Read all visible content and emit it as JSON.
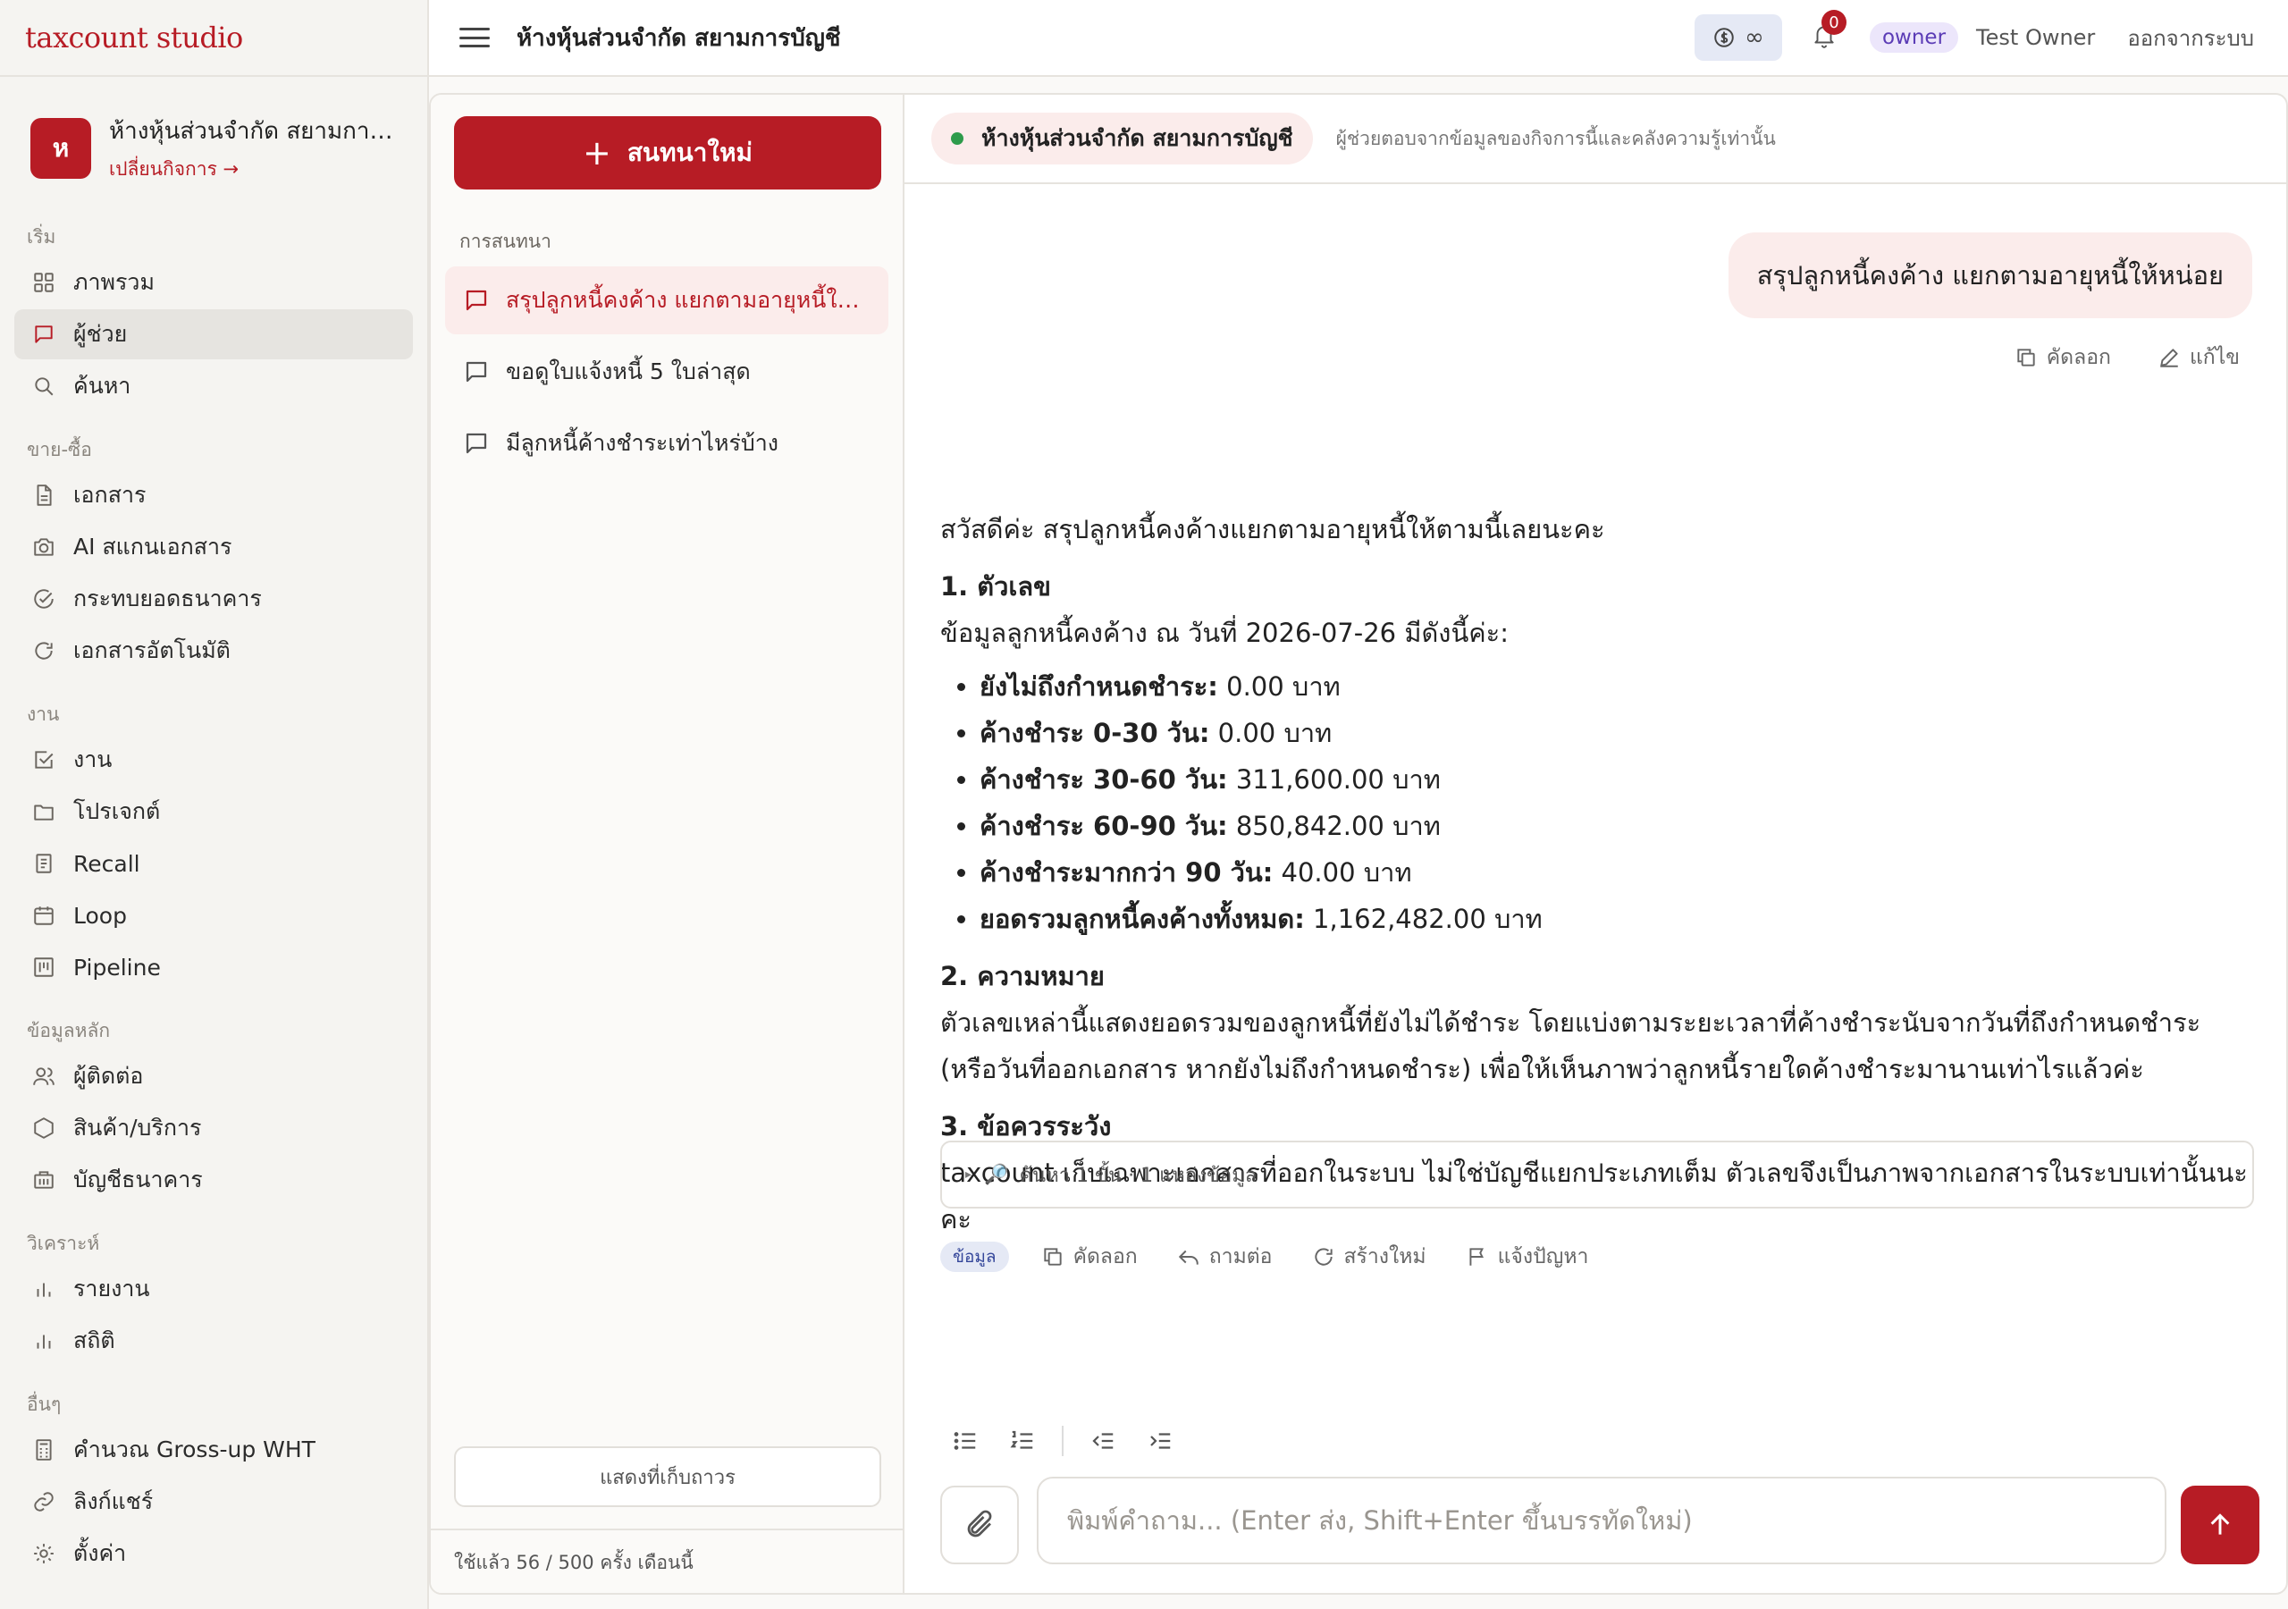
{
  "brand": "taxcount studio",
  "business": {
    "avatar_letter": "ห",
    "name": "ห้างหุ้นส่วนจำกัด สยามการบัญชี",
    "switch_label": "เปลี่ยนกิจการ →"
  },
  "sidebar": {
    "sections": {
      "start": "เริ่ม",
      "sales": "ขาย-ซื้อ",
      "work": "งาน",
      "master": "ข้อมูลหลัก",
      "analytics": "วิเคราะห์",
      "other": "อื่นๆ"
    },
    "items": {
      "overview": "ภาพรวม",
      "assistant": "ผู้ช่วย",
      "search": "ค้นหา",
      "documents": "เอกสาร",
      "ai_scan": "AI สแกนเอกสาร",
      "bank_recon": "กระทบยอดธนาคาร",
      "auto_docs": "เอกสารอัตโนมัติ",
      "tasks": "งาน",
      "projects": "โปรเจกต์",
      "recall": "Recall",
      "loop": "Loop",
      "pipeline": "Pipeline",
      "contacts": "ผู้ติดต่อ",
      "products": "สินค้า/บริการ",
      "bank_accounts": "บัญชีธนาคาร",
      "reports": "รายงาน",
      "stats": "สถิติ",
      "grossup": "คำนวณ Gross-up WHT",
      "share_links": "ลิงก์แชร์",
      "settings": "ตั้งค่า"
    }
  },
  "topbar": {
    "title": "ห้างหุ้นส่วนจำกัด สยามการบัญชี",
    "credit": "∞",
    "notifications": "0",
    "role": "owner",
    "user": "Test Owner",
    "logout": "ออกจากระบบ"
  },
  "conversations": {
    "new_chat": "สนทนาใหม่",
    "heading": "การสนทนา",
    "items": [
      "สรุปลูกหนี้คงค้าง แยกตามอายุหนี้ให้หน่อย",
      "ขอดูใบแจ้งหนี้ 5 ใบล่าสุด",
      "มีลูกหนี้ค้างชำระเท่าไหร่บ้าง"
    ],
    "archived": "แสดงที่เก็บถาวร",
    "usage": "ใช้แล้ว 56 / 500 ครั้ง เดือนนี้"
  },
  "chat": {
    "business_pill": "ห้างหุ้นส่วนจำกัด สยามการบัญชี",
    "note": "ผู้ช่วยตอบจากข้อมูลของกิจการนี้และคลังความรู้เท่านั้น",
    "user_message": "สรุปลูกหนี้คงค้าง แยกตามอายุหนี้ให้หน่อย",
    "copy": "คัดลอก",
    "edit": "แก้ไข",
    "answer": {
      "greeting": "สวัสดีค่ะ สรุปลูกหนี้คงค้างแยกตามอายุหนี้ให้ตามนี้เลยนะคะ",
      "h1": "1. ตัวเลข",
      "intro": "ข้อมูลลูกหนี้คงค้าง ณ วันที่ 2026-07-26 มีดังนี้ค่ะ:",
      "rows": [
        {
          "label": "ยังไม่ถึงกำหนดชำระ:",
          "value": " 0.00 บาท"
        },
        {
          "label": "ค้างชำระ 0-30 วัน:",
          "value": " 0.00 บาท"
        },
        {
          "label": "ค้างชำระ 30-60 วัน:",
          "value": " 311,600.00 บาท"
        },
        {
          "label": "ค้างชำระ 60-90 วัน:",
          "value": " 850,842.00 บาท"
        },
        {
          "label": "ค้างชำระมากกว่า 90 วัน:",
          "value": " 40.00 บาท"
        },
        {
          "label": "ยอดรวมลูกหนี้คงค้างทั้งหมด:",
          "value": " 1,162,482.00 บาท"
        }
      ],
      "h2": "2. ความหมาย",
      "meaning": "ตัวเลขเหล่านี้แสดงยอดรวมของลูกหนี้ที่ยังไม่ได้ชำระ โดยแบ่งตามระยะเวลาที่ค้างชำระนับจากวันที่ถึงกำหนดชำระ (หรือวันที่ออกเอกสาร หากยังไม่ถึงกำหนดชำระ) เพื่อให้เห็นภาพว่าลูกหนี้รายใดค้างชำระมานานเท่าไรแล้วค่ะ",
      "h3": "3. ข้อควรระวัง",
      "caution": "taxcount เก็บเฉพาะเอกสารที่ออกในระบบ ไม่ใช่บัญชีแยกประเภทเต็ม ตัวเลขจึงเป็นภาพจากเอกสารในระบบเท่านั้นนะคะ"
    },
    "search_summary": "ค้นหา 1 ขั้น · 1 แหล่งข้อมูล",
    "info_tag": "ข้อมูล",
    "actions": {
      "copy": "คัดลอก",
      "follow_up": "ถามต่อ",
      "regenerate": "สร้างใหม่",
      "report": "แจ้งปัญหา"
    },
    "input_placeholder": "พิมพ์คำถาม... (Enter ส่ง, Shift+Enter ขึ้นบรรทัดใหม่)",
    "input_value": ""
  }
}
